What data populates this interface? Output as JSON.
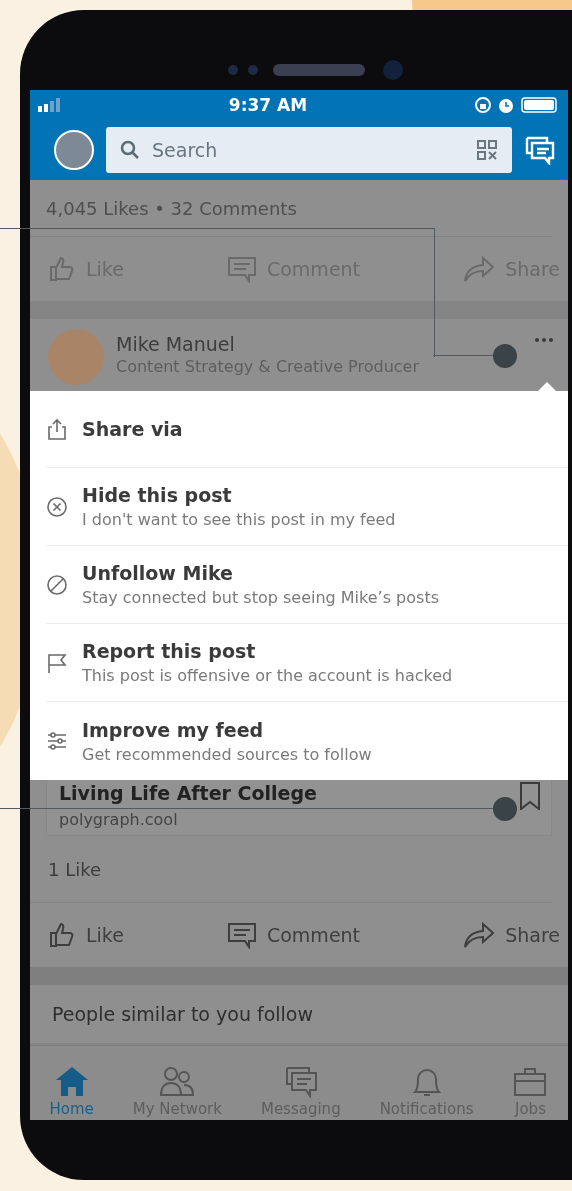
{
  "status_bar": {
    "time": "9:37 AM"
  },
  "search": {
    "placeholder": "Search"
  },
  "previous_post": {
    "stats": "4,045 Likes • 32 Comments",
    "actions": [
      {
        "kind": "like",
        "label": "Like"
      },
      {
        "kind": "comment",
        "label": "Comment"
      },
      {
        "kind": "share",
        "label": "Share"
      }
    ]
  },
  "post": {
    "author": "Mike Manuel",
    "headline": "Content Strategy & Creative Producer",
    "menu": [
      {
        "kind": "share",
        "label": "Share via"
      },
      {
        "kind": "hide",
        "label": "Hide this post",
        "description": "I don't want to see this post in my feed"
      },
      {
        "kind": "unfollow",
        "label": "Unfollow Mike",
        "description": "Stay connected but stop seeing Mike’s posts"
      },
      {
        "kind": "report",
        "label": "Report this post",
        "description": "This post is offensive or the account is hacked"
      },
      {
        "kind": "improve",
        "label": "Improve my feed",
        "description": "Get recommended sources to follow"
      }
    ],
    "link": {
      "title": "Living Life After College",
      "domain": "polygraph.cool"
    },
    "likes": "1 Like",
    "actions": [
      {
        "kind": "like",
        "label": "Like"
      },
      {
        "kind": "comment",
        "label": "Comment"
      },
      {
        "kind": "share",
        "label": "Share"
      }
    ]
  },
  "suggestion": "People similar to you follow",
  "bottom_nav": [
    {
      "kind": "home",
      "label": "Home",
      "selected": true
    },
    {
      "kind": "network",
      "label": "My Network",
      "selected": false
    },
    {
      "kind": "messaging",
      "label": "Messaging",
      "selected": false
    },
    {
      "kind": "notifications",
      "label": "Notifications",
      "selected": false
    },
    {
      "kind": "jobs",
      "label": "Jobs",
      "selected": false
    }
  ]
}
